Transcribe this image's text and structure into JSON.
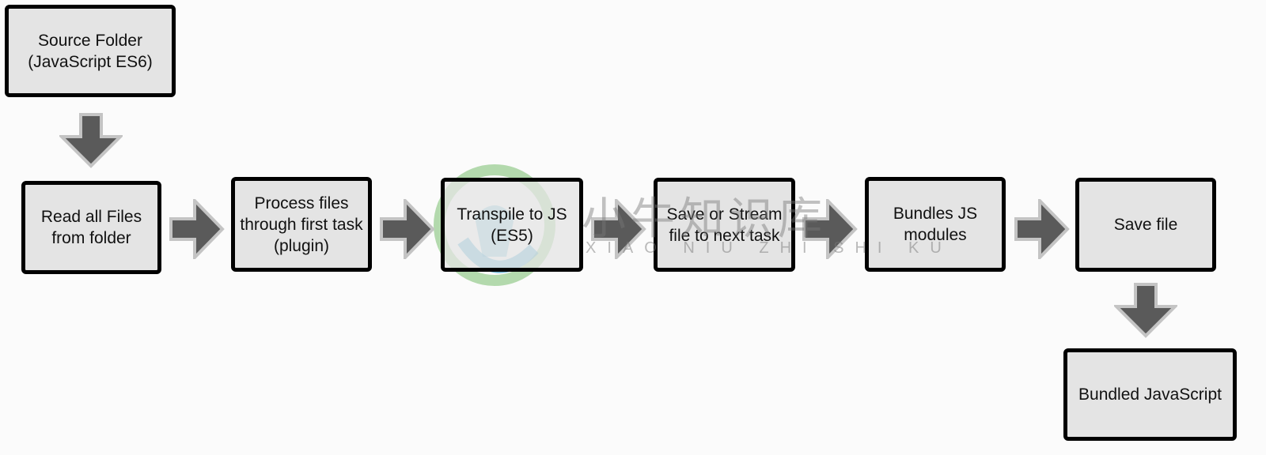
{
  "nodes": {
    "source": "Source Folder (JavaScript ES6)",
    "read": "Read all Files from folder",
    "process": "Process files through first task (plugin)",
    "transpile": "Transpile to JS (ES5)",
    "save_stream": "Save or Stream file to next task",
    "bundles": "Bundles JS modules",
    "save_file": "Save file",
    "bundled": "Bundled JavaScript"
  },
  "watermark": {
    "text": "小牛知识库",
    "subtext": "XIAO NIU ZHI SHI KU"
  },
  "colors": {
    "box_fill": "#e4e4e4",
    "box_border": "#000000",
    "arrow_fill": "#5a5a5a",
    "arrow_outline": "#c4c4c4"
  }
}
